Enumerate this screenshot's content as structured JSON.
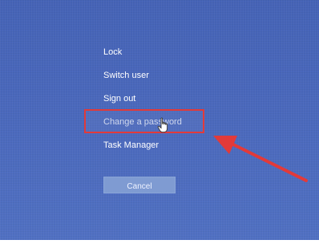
{
  "menu": {
    "items": [
      {
        "label": "Lock"
      },
      {
        "label": "Switch user"
      },
      {
        "label": "Sign out"
      },
      {
        "label": "Change a password"
      },
      {
        "label": "Task Manager"
      }
    ],
    "cancel_label": "Cancel"
  },
  "annotation": {
    "highlight_color": "#e23a3a",
    "arrow_color": "#e23a3a",
    "cursor_icon": "hand-pointer-icon"
  }
}
